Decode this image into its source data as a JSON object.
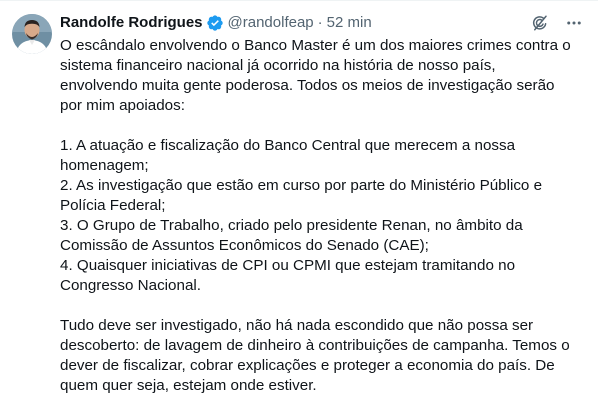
{
  "tweet": {
    "author": {
      "display_name": "Randolfe Rodrigues",
      "handle": "@randolfeap",
      "verified": true,
      "avatar_icon": "avatar-photo"
    },
    "separator": "·",
    "time": "52 min",
    "actions": [
      {
        "name": "grok-icon"
      },
      {
        "name": "more-icon"
      }
    ],
    "paragraphs": [
      "O escândalo envolvendo o Banco Master é um dos maiores crimes contra o\nsistema financeiro nacional já ocorrido na história de nosso país,\nenvolvendo muita gente poderosa. Todos os meios de investigação serão\npor mim apoiados:",
      "1. A atuação e fiscalização do Banco Central que merecem a nossa\nhomenagem;\n2. As investigação que estão em curso por parte do Ministério Público e\nPolícia Federal;\n3. O Grupo de Trabalho, criado pelo presidente Renan, no âmbito da\nComissão de Assuntos Econômicos do Senado (CAE);\n4. Quaisquer iniciativas de CPI ou CPMI que estejam tramitando no\nCongresso Nacional.",
      "Tudo deve ser investigado, não há nada escondido que não possa ser\ndescoberto: de lavagem de dinheiro à contribuições de campanha. Temos o\ndever de fiscalizar, cobrar explicações e proteger a economia do país. De\nquem quer seja, estejam onde estiver."
    ]
  },
  "colors": {
    "text_primary": "#0f1419",
    "text_secondary": "#536471",
    "verified_badge": "#1d9bf0",
    "divider": "#eff3f4"
  }
}
